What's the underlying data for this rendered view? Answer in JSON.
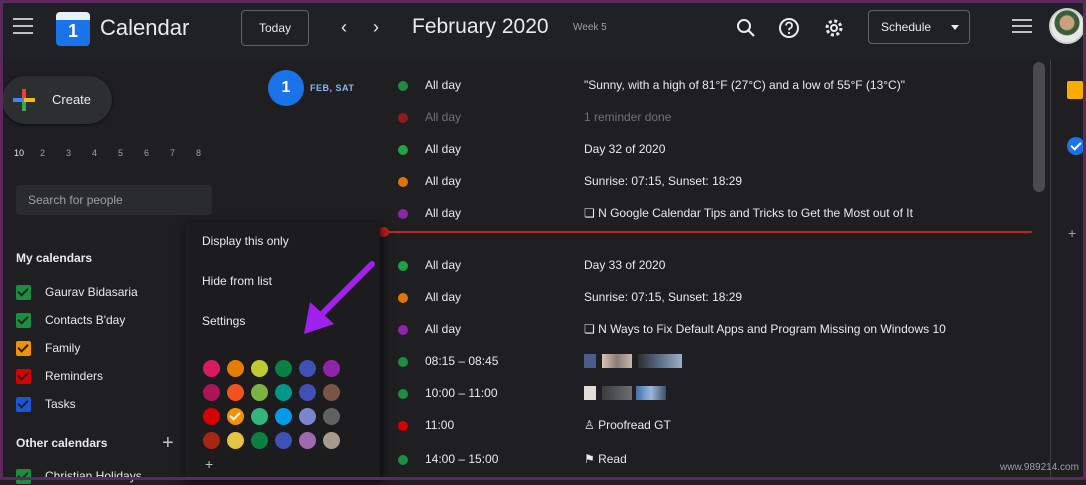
{
  "header": {
    "app_name": "Calendar",
    "logo_number": "1",
    "today_label": "Today",
    "prev_icon": "chevron-left-icon",
    "next_icon": "chevron-right-icon",
    "month_title": "February 2020",
    "week_label": "Week 5",
    "view_select": "Schedule"
  },
  "sidebar": {
    "create_label": "Create",
    "mini_days": [
      "10",
      "2",
      "3",
      "4",
      "5",
      "6",
      "7",
      "8"
    ],
    "search_placeholder": "Search for people",
    "my_calendars_title": "My calendars",
    "my_calendars": [
      {
        "name": "Gaurav Bidasaria",
        "color": "#1e8e3e"
      },
      {
        "name": "Contacts B'day",
        "color": "#1e8e3e"
      },
      {
        "name": "Family",
        "color": "#f09300"
      },
      {
        "name": "Reminders",
        "color": "#d50000"
      },
      {
        "name": "Tasks",
        "color": "#1a56d6"
      }
    ],
    "other_calendars_title": "Other calendars",
    "other_calendars": [
      {
        "name": "Christian Holidays",
        "color": "#1e8e3e"
      }
    ]
  },
  "agenda": {
    "date_number": "1",
    "date_label": "FEB, SAT",
    "events": [
      {
        "time": "All day",
        "title": "\"Sunny, with a high of 81°F (27°C) and a low of 55°F (13°C)\"",
        "color": "#1e8e3e",
        "dim": false
      },
      {
        "time": "All day",
        "title": "1 reminder done",
        "color": "#8c1d18",
        "dim": true
      },
      {
        "time": "All day",
        "title": "Day 32 of 2020",
        "color": "#1ea446",
        "dim": false
      },
      {
        "time": "All day",
        "title": "Sunrise: 07:15, Sunset: 18:29",
        "color": "#e37400",
        "dim": false
      },
      {
        "time": "All day",
        "title": "❏ N Google Calendar Tips and Tricks to Get the Most out of It",
        "color": "#8e24aa",
        "dim": false
      },
      {
        "time": "All day",
        "title": "Day 33 of 2020",
        "color": "#1ea446",
        "dim": false
      },
      {
        "time": "All day",
        "title": "Sunrise: 07:15, Sunset: 18:29",
        "color": "#e37400",
        "dim": false
      },
      {
        "time": "All day",
        "title": "❏ N Ways to Fix Default Apps and Program Missing on Windows 10",
        "color": "#8e24aa",
        "dim": false
      },
      {
        "time": "08:15 – 08:45",
        "title": "",
        "color": "#1e8e3e",
        "dim": false
      },
      {
        "time": "10:00 – 11:00",
        "title": "",
        "color": "#1e8e3e",
        "dim": false
      },
      {
        "time": "11:00",
        "title": "♙ Proofread GT",
        "color": "#d50000",
        "dim": false
      },
      {
        "time": "14:00 – 15:00",
        "title": "⚑ Read",
        "color": "#1e8e3e",
        "dim": false
      }
    ]
  },
  "context_menu": {
    "items": [
      "Display this only",
      "Hide from list",
      "Settings"
    ],
    "colors": [
      [
        "#d81b60",
        "#e67c00",
        "#c0ca33",
        "#0b8043",
        "#3f51b5",
        "#8e24aa"
      ],
      [
        "#ad1457",
        "#f4511e",
        "#7cb342",
        "#009688",
        "#4050b5",
        "#795548"
      ],
      [
        "#d50000",
        "#f09300",
        "#33b679",
        "#039be5",
        "#7986cb",
        "#616161"
      ],
      [
        "#a52714",
        "#e4c441",
        "#0b8043",
        "#3f51b5",
        "#9e69af",
        "#a79b8e"
      ]
    ],
    "selected_color": "#f09300"
  },
  "watermark": "www.989214.com",
  "icons": {
    "menu": "hamburger-menu-icon",
    "search": "search-icon",
    "help": "help-icon",
    "settings": "gear-icon",
    "apps": "apps-icon",
    "keep": "keep-icon",
    "tasks": "tasks-icon"
  }
}
